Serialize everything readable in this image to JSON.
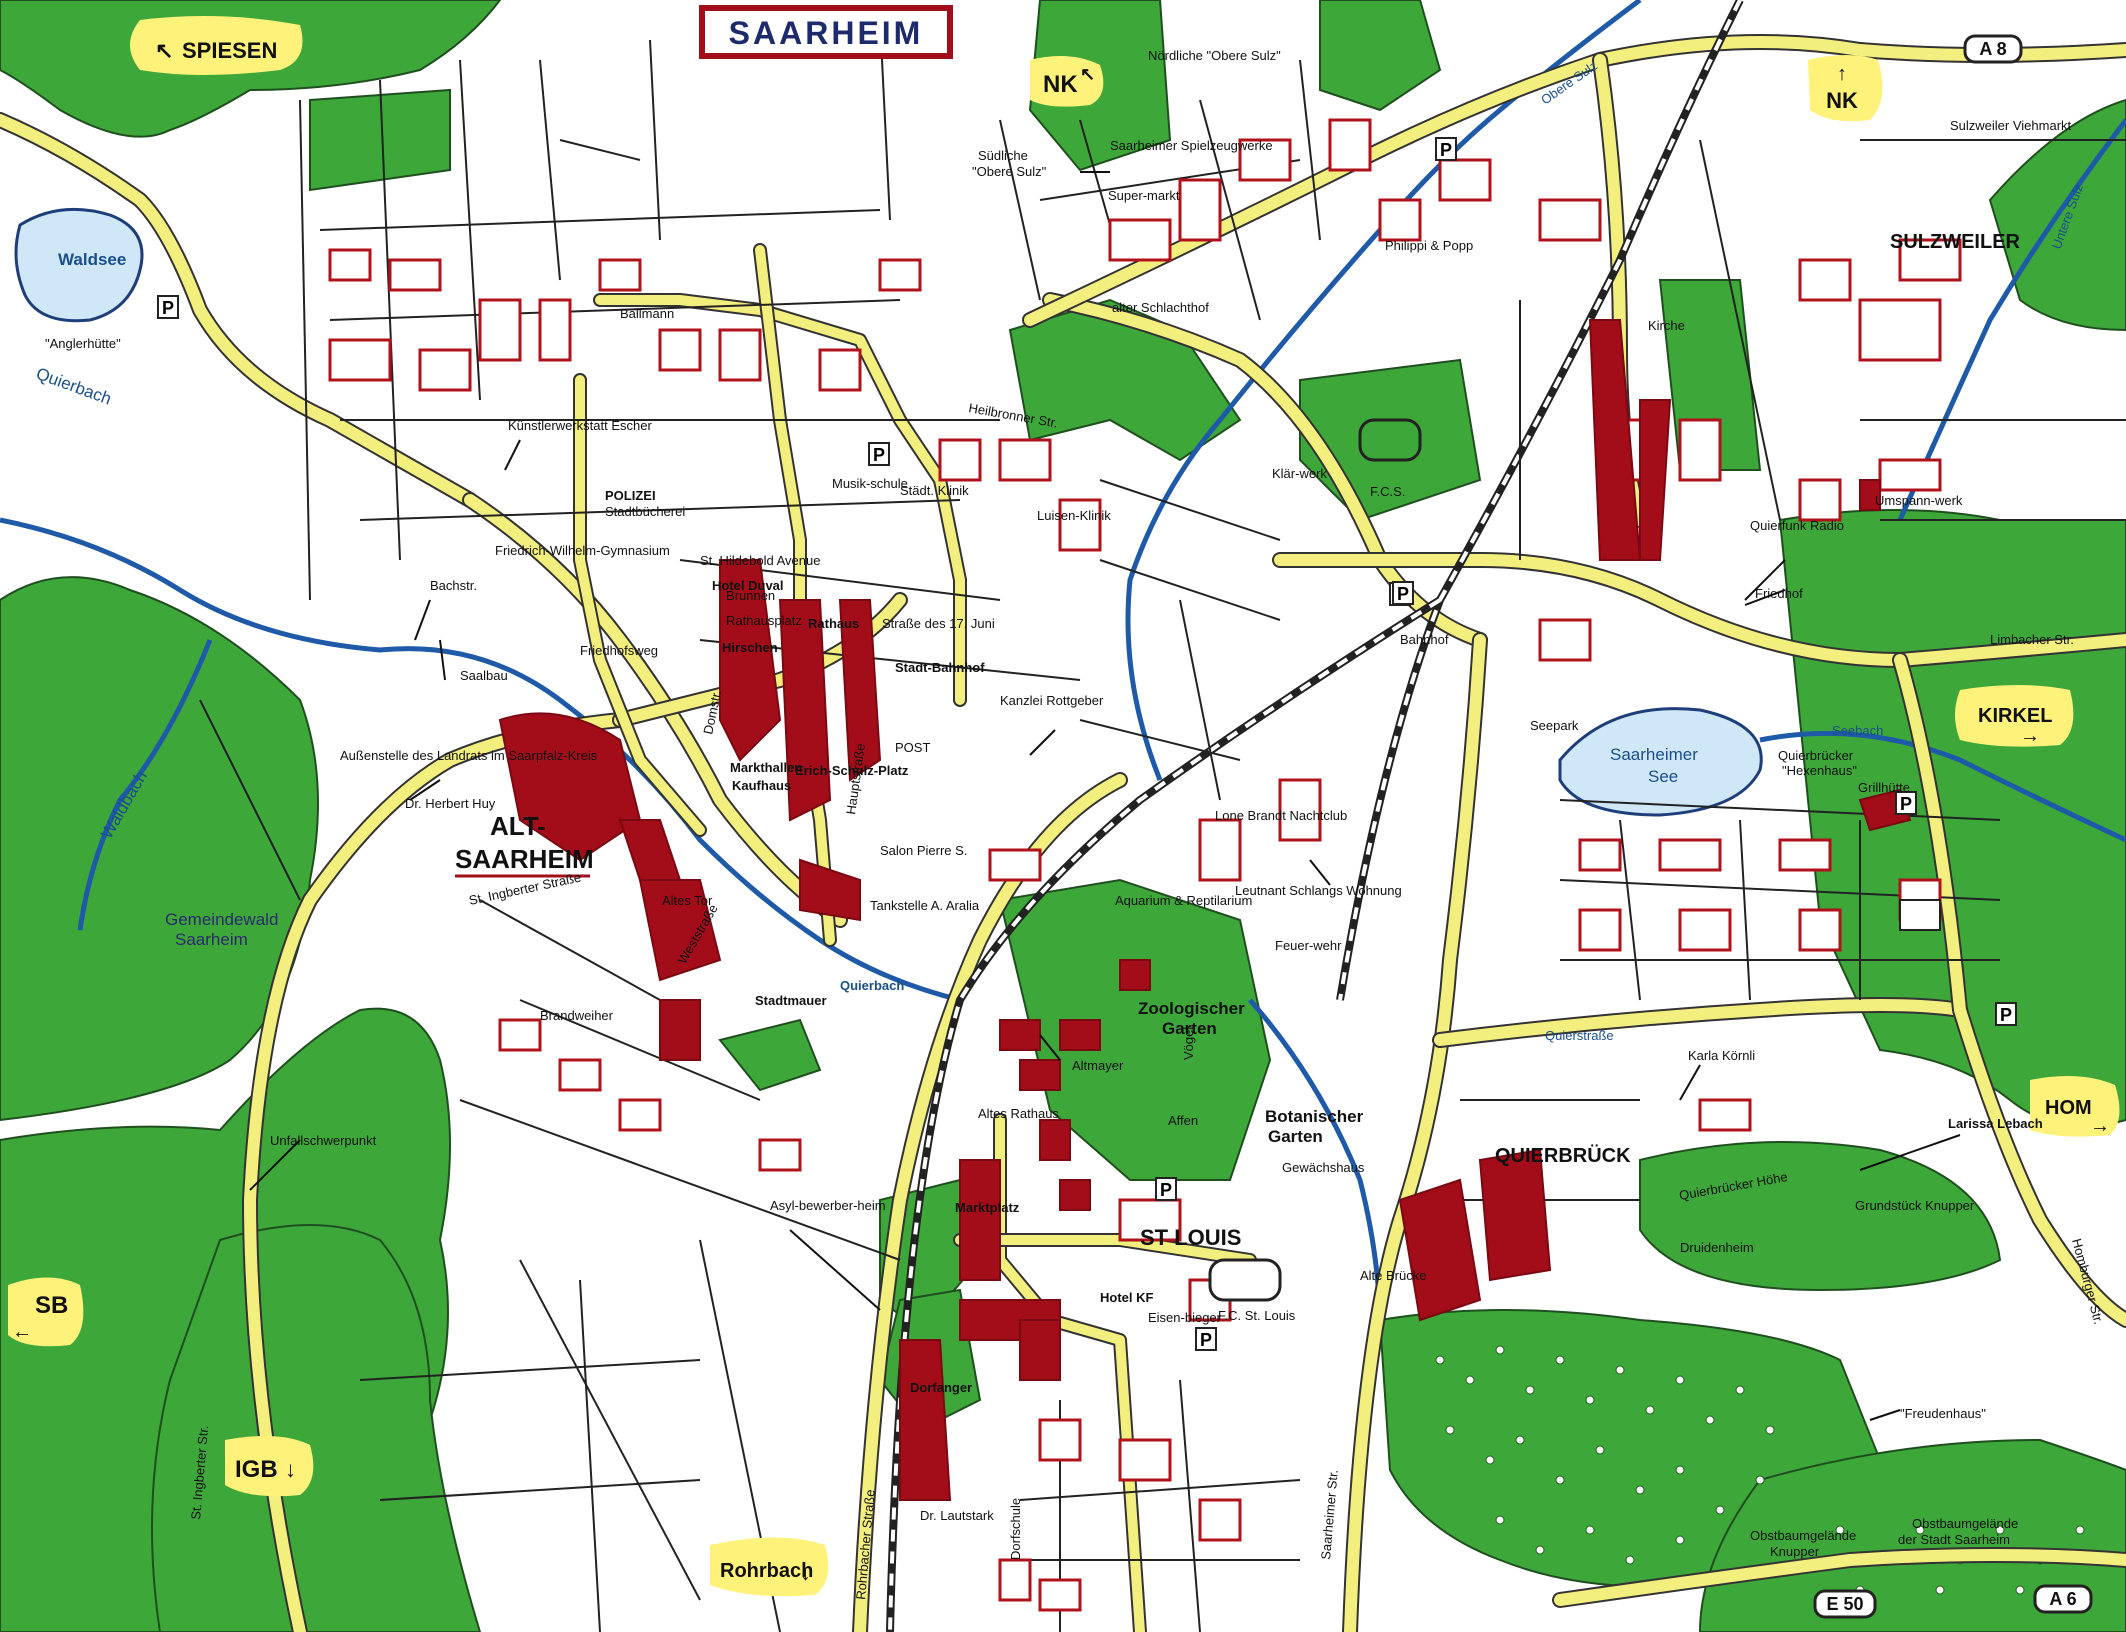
{
  "map": {
    "title": "SAARHEIM",
    "colors": {
      "park": "#3ea73a",
      "major_road": "#f3ef7f",
      "building_outline": "#b0121b",
      "building_fill": "#a30d1a",
      "water": "#cfe7f7",
      "river": "#1e5aa8",
      "highlight_badge": "#fff27a"
    },
    "direction_badges": [
      {
        "id": "spiesen",
        "text": "SPIESEN",
        "arrow": "↖"
      },
      {
        "id": "nk-top",
        "text": "NK",
        "arrow": "↖"
      },
      {
        "id": "nk-right",
        "text": "NK",
        "arrow": "↑"
      },
      {
        "id": "kirkel",
        "text": "KIRKEL",
        "arrow": "→"
      },
      {
        "id": "hom",
        "text": "HOM",
        "arrow": "→"
      },
      {
        "id": "sb",
        "text": "SB",
        "arrow": "←"
      },
      {
        "id": "igb",
        "text": "IGB",
        "arrow": "↓"
      },
      {
        "id": "rohrbach",
        "text": "Rohrbach",
        "arrow": "↓"
      }
    ],
    "highway_shields": [
      {
        "id": "a8",
        "text": "A 8"
      },
      {
        "id": "a6",
        "text": "A 6"
      },
      {
        "id": "e50",
        "text": "E 50"
      }
    ],
    "district_labels": [
      {
        "id": "alt-saarheim-1",
        "text": "ALT-"
      },
      {
        "id": "alt-saarheim-2",
        "text": "SAARHEIM"
      },
      {
        "id": "sulzweiler",
        "text": "SULZWEILER"
      },
      {
        "id": "querbrueck",
        "text": "QUIERBRÜCK"
      },
      {
        "id": "st-louis",
        "text": "ST LOUIS"
      }
    ],
    "place_labels": [
      {
        "id": "noerdliche-obere-sulz",
        "text": "Nördliche \"Obere Sulz\""
      },
      {
        "id": "suedliche-1",
        "text": "Südliche"
      },
      {
        "id": "suedliche-2",
        "text": "\"Obere Sulz\""
      },
      {
        "id": "waldsee",
        "text": "Waldsee"
      },
      {
        "id": "anglerhuette",
        "text": "\"Anglerhütte\""
      },
      {
        "id": "quierbach-left",
        "text": "Quierbach"
      },
      {
        "id": "waldbach",
        "text": "Waldbach"
      },
      {
        "id": "gemeindewald-1",
        "text": "Gemeindewald"
      },
      {
        "id": "gemeindewald-2",
        "text": "Saarheim"
      },
      {
        "id": "ballmann",
        "text": "Ballmann"
      },
      {
        "id": "kuenstlerwerkstatt",
        "text": "Künstlerwerkstatt Escher"
      },
      {
        "id": "polizei",
        "text": "POLIZEI"
      },
      {
        "id": "stadtbuecherei",
        "text": "Stadtbücherei"
      },
      {
        "id": "friedrich-wilhelm",
        "text": "Friedrich-Wilhelm-Gymnasium"
      },
      {
        "id": "bachstr",
        "text": "Bachstr."
      },
      {
        "id": "saalbau",
        "text": "Saalbau"
      },
      {
        "id": "aussenstelle",
        "text": "Außenstelle des Landrats im Saarpfalz-Kreis"
      },
      {
        "id": "dr-huy",
        "text": "Dr. Herbert Huy"
      },
      {
        "id": "st-ingberter-strasse",
        "text": "St. Ingberter Straße"
      },
      {
        "id": "st-ingberter-str-v",
        "text": "St. Ingberter Str."
      },
      {
        "id": "unfallschwerpunkt",
        "text": "Unfallschwerpunkt"
      },
      {
        "id": "brandweiher",
        "text": "Brandweiher"
      },
      {
        "id": "friedhofsweg",
        "text": "Friedhofsweg"
      },
      {
        "id": "domstr",
        "text": "Domstr."
      },
      {
        "id": "hauptstrasse",
        "text": "Hauptstraße"
      },
      {
        "id": "st-hildebold",
        "text": "St. Hildebold Avenue"
      },
      {
        "id": "hotel-duval",
        "text": "Hotel Duval"
      },
      {
        "id": "brunnen",
        "text": "Brunnen"
      },
      {
        "id": "rathausplatz",
        "text": "Rathausplatz"
      },
      {
        "id": "rathaus",
        "text": "Rathaus"
      },
      {
        "id": "hirschen",
        "text": "Hirschen"
      },
      {
        "id": "markthallen",
        "text": "Markthallen"
      },
      {
        "id": "kaufhaus",
        "text": "Kaufhaus"
      },
      {
        "id": "erich-schulz-platz",
        "text": "Erich-Schulz-Platz"
      },
      {
        "id": "altes-tor",
        "text": "Altes Tor"
      },
      {
        "id": "weststrasse",
        "text": "Weststraße"
      },
      {
        "id": "quierbach-center",
        "text": "Quierbach"
      },
      {
        "id": "stadtmauer",
        "text": "Stadtmauer"
      },
      {
        "id": "tankstelle",
        "text": "Tankstelle A. Aralia"
      },
      {
        "id": "salon-pierre",
        "text": "Salon Pierre S."
      },
      {
        "id": "post",
        "text": "POST"
      },
      {
        "id": "stadtbahnhof",
        "text": "Stadt-Bahnhof"
      },
      {
        "id": "strasse-des-17-juni",
        "text": "Straße des 17. Juni"
      },
      {
        "id": "kanzlei",
        "text": "Kanzlei Rottgeber"
      },
      {
        "id": "musikschule",
        "text": "Musik-schule"
      },
      {
        "id": "staedt-klinik",
        "text": "Städt. Klinik"
      },
      {
        "id": "luisen-klinik",
        "text": "Luisen-Klinik"
      },
      {
        "id": "heilbronner-str",
        "text": "Heilbronner Str."
      },
      {
        "id": "supermarkt",
        "text": "Super-markt"
      },
      {
        "id": "spielzeugwerke",
        "text": "Saarheimer Spielzeugwerke"
      },
      {
        "id": "alter-schlachthof",
        "text": "alter Schlachthof"
      },
      {
        "id": "philippi-popp",
        "text": "Philippi & Popp"
      },
      {
        "id": "obere-sulz",
        "text": "Obere Sulz"
      },
      {
        "id": "untere-sulz",
        "text": "Untere Sulz"
      },
      {
        "id": "sulzweiler-viehmarkt",
        "text": "Sulzweiler Viehmarkt"
      },
      {
        "id": "kirche-sulzweiler",
        "text": "Kirche"
      },
      {
        "id": "umspannwerk",
        "text": "Umspann-werk"
      },
      {
        "id": "quierfunk-radio",
        "text": "Quierfunk Radio"
      },
      {
        "id": "friedhof-right",
        "text": "Friedhof"
      },
      {
        "id": "limbacher-str",
        "text": "Limbacher Str."
      },
      {
        "id": "bahnhof",
        "text": "Bahnhof"
      },
      {
        "id": "klaerwerk",
        "text": "Klär-werk"
      },
      {
        "id": "fcs",
        "text": "F.C.S."
      },
      {
        "id": "saarheimer-see-1",
        "text": "Saarheimer"
      },
      {
        "id": "saarheimer-see-2",
        "text": "See"
      },
      {
        "id": "seebach",
        "text": "Seebach"
      },
      {
        "id": "seepark",
        "text": "Seepark"
      },
      {
        "id": "hexenhaus-1",
        "text": "Quierbrücker"
      },
      {
        "id": "hexenhaus-2",
        "text": "\"Hexenhaus\""
      },
      {
        "id": "grillhuette",
        "text": "Grillhütte"
      },
      {
        "id": "lone-brandt",
        "text": "Lone Brandt Nachtclub"
      },
      {
        "id": "leutnant-schlang",
        "text": "Leutnant Schlangs Wohnung"
      },
      {
        "id": "feuerwehr",
        "text": "Feuer-wehr"
      },
      {
        "id": "aquarium",
        "text": "Aquarium & Reptilarium"
      },
      {
        "id": "zoologischer-1",
        "text": "Zoologischer"
      },
      {
        "id": "zoologischer-2",
        "text": "Garten"
      },
      {
        "id": "altmayer",
        "text": "Altmayer"
      },
      {
        "id": "altes-rathaus",
        "text": "Altes Rathaus"
      },
      {
        "id": "affen",
        "text": "Affen"
      },
      {
        "id": "voegel",
        "text": "Vögel"
      },
      {
        "id": "botanischer-1",
        "text": "Botanischer"
      },
      {
        "id": "botanischer-2",
        "text": "Garten"
      },
      {
        "id": "gewaechshaus",
        "text": "Gewächshaus"
      },
      {
        "id": "quierstrasse",
        "text": "Quierstraße"
      },
      {
        "id": "karla-koernli",
        "text": "Karla Körnli"
      },
      {
        "id": "larissa-lebach",
        "text": "Larissa Lebach"
      },
      {
        "id": "grundstueck-knupper",
        "text": "Grundstück Knupper"
      },
      {
        "id": "druidenheim",
        "text": "Druidenheim"
      },
      {
        "id": "quierbruecker-hoehe",
        "text": "Quierbrücker Höhe"
      },
      {
        "id": "alte-bruecke",
        "text": "Alte Brücke"
      },
      {
        "id": "asylbewerberheim",
        "text": "Asyl-bewerber-heim"
      },
      {
        "id": "marktplatz",
        "text": "Marktplatz"
      },
      {
        "id": "dorfanger",
        "text": "Dorfanger"
      },
      {
        "id": "dr-lautstark",
        "text": "Dr. Lautstark"
      },
      {
        "id": "dorfschule",
        "text": "Dorfschule"
      },
      {
        "id": "eisenbieger",
        "text": "Eisen-bieger"
      },
      {
        "id": "hotel-kf",
        "text": "Hotel KF"
      },
      {
        "id": "fc-st-louis",
        "text": "F.C. St. Louis"
      },
      {
        "id": "freudenhaus",
        "text": "\"Freudenhaus\""
      },
      {
        "id": "obstbaum-knupper-1",
        "text": "Obstbaumgelände"
      },
      {
        "id": "obstbaum-knupper-2",
        "text": "Knupper"
      },
      {
        "id": "obstbaum-stadt-1",
        "text": "Obstbaumgelände"
      },
      {
        "id": "obstbaum-stadt-2",
        "text": "der Stadt Saarheim"
      },
      {
        "id": "homburger-str",
        "text": "Homburger Str."
      },
      {
        "id": "rohrbacher-strasse",
        "text": "Rohrbacher Straße"
      },
      {
        "id": "saarheimer-str-v",
        "text": "Saarheimer Str."
      }
    ]
  }
}
